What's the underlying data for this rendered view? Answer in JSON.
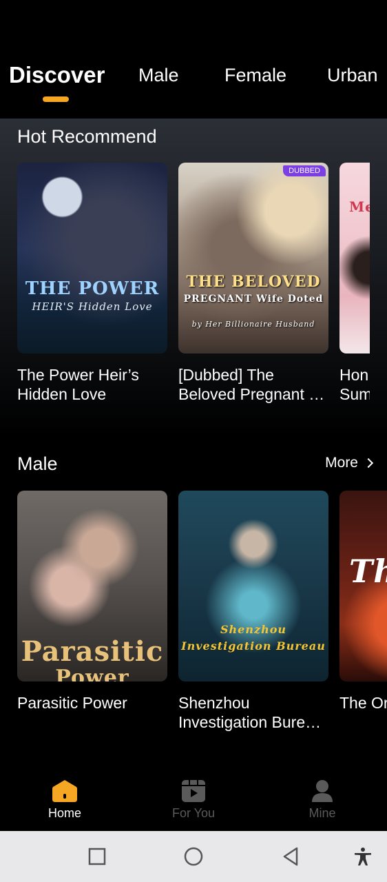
{
  "tabs": [
    {
      "label": "Discover",
      "active": true
    },
    {
      "label": "Male",
      "active": false
    },
    {
      "label": "Female",
      "active": false
    },
    {
      "label": "Urban",
      "active": false
    }
  ],
  "hot": {
    "title": "Hot Recommend",
    "cards": [
      {
        "title": "The Power Heir’s Hidden Love",
        "poster_text": "THE POWER",
        "poster_sub": "HEIR'S Hidden Love"
      },
      {
        "title": "[Dubbed] The Beloved Pregnant …",
        "badge": "DUBBED",
        "poster_text": "THE BELOVED",
        "poster_sub": "PREGNANT Wife Doted",
        "poster_sub2": "by Her Billionaire Husband"
      },
      {
        "title": "Hon… Sum…",
        "line1": "Hon",
        "line2": "Sum",
        "poster_text": "Me"
      }
    ]
  },
  "male": {
    "title": "Male",
    "more_label": "More",
    "cards": [
      {
        "title": "Parasitic Power",
        "poster_text": "Parasitic",
        "poster_sub": "Power"
      },
      {
        "title": "Shenzhou Investigation Bure…",
        "poster_text": "Shenzhou",
        "poster_sub": "Investigation Bureau"
      },
      {
        "title": "The Or…",
        "line1": "The Or",
        "poster_text": "Th"
      }
    ]
  },
  "bottom_nav": [
    {
      "label": "Home",
      "icon": "home-icon",
      "active": true
    },
    {
      "label": "For You",
      "icon": "play-video-icon",
      "active": false
    },
    {
      "label": "Mine",
      "icon": "person-icon",
      "active": false
    }
  ],
  "colors": {
    "accent": "#f5a623",
    "inactive": "#5a5a5a",
    "badge": "#7b3fe4"
  }
}
